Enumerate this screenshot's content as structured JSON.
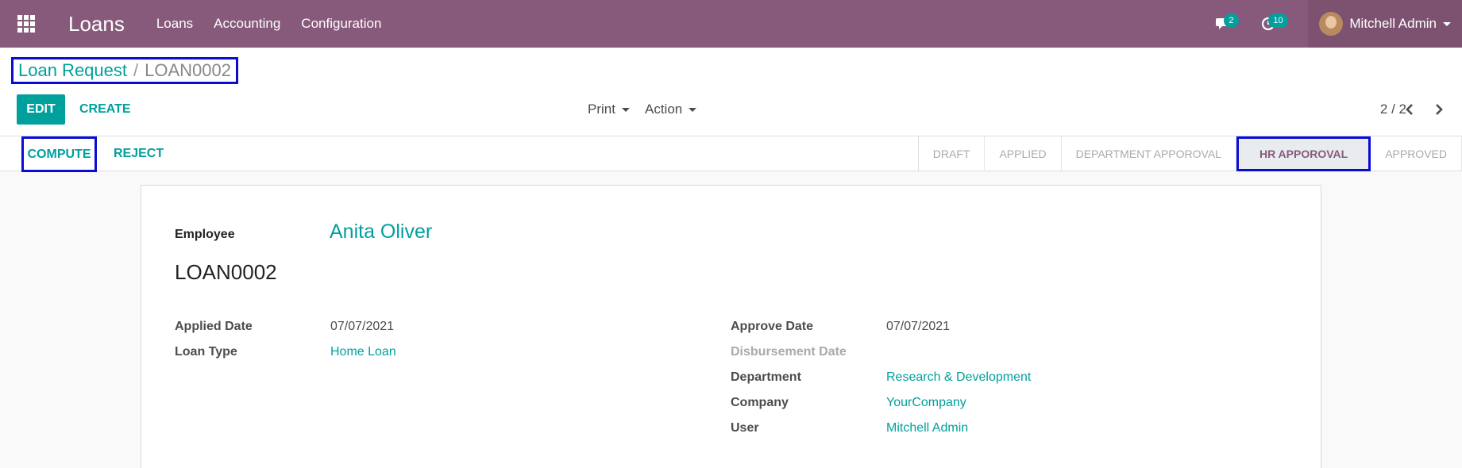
{
  "navbar": {
    "app_title": "Loans",
    "menu": [
      "Loans",
      "Accounting",
      "Configuration"
    ],
    "messages_badge": "2",
    "activities_badge": "10",
    "user_name": "Mitchell Admin"
  },
  "breadcrumb": {
    "parent": "Loan Request",
    "separator": "/",
    "current": "LOAN0002"
  },
  "toolbar": {
    "edit_label": "EDIT",
    "create_label": "CREATE",
    "print_label": "Print",
    "action_label": "Action",
    "pager": "2 / 2"
  },
  "statusbar": {
    "compute_label": "COMPUTE",
    "reject_label": "REJECT",
    "stages": [
      "DRAFT",
      "APPLIED",
      "DEPARTMENT APPOROVAL",
      "HR APPOROVAL",
      "APPROVED"
    ],
    "active_stage": "HR APPOROVAL"
  },
  "form": {
    "employee_label": "Employee",
    "employee_value": "Anita Oliver",
    "reference": "LOAN0002",
    "left": {
      "applied_date_label": "Applied Date",
      "applied_date_value": "07/07/2021",
      "loan_type_label": "Loan Type",
      "loan_type_value": "Home Loan"
    },
    "right": {
      "approve_date_label": "Approve Date",
      "approve_date_value": "07/07/2021",
      "disbursement_date_label": "Disbursement Date",
      "department_label": "Department",
      "department_value": "Research & Development",
      "company_label": "Company",
      "company_value": "YourCompany",
      "user_label": "User",
      "user_value": "Mitchell Admin"
    }
  },
  "colors": {
    "navbar": "#875a7b",
    "accent": "#00a09d",
    "highlight_box": "#0b0bd6"
  }
}
